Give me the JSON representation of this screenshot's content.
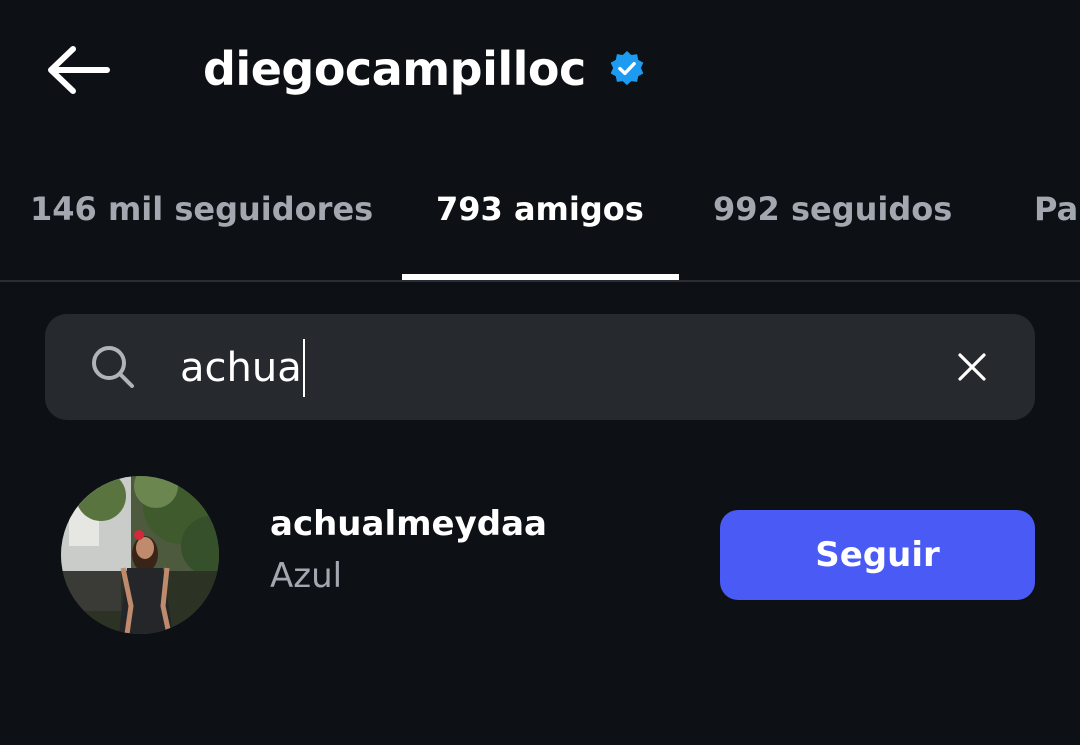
{
  "header": {
    "title": "diegocampilloc",
    "verified": true,
    "back_icon": "arrow-left-icon",
    "verified_icon": "verified-badge-icon",
    "verified_color": "#1d9bf0"
  },
  "tabs": [
    {
      "label": "146 mil seguidores",
      "active": false
    },
    {
      "label": "793 amigos",
      "active": true
    },
    {
      "label": "992 seguidos",
      "active": false
    },
    {
      "label": "Pa",
      "active": false
    }
  ],
  "search": {
    "value": "achua",
    "icon": "search-icon",
    "clear_icon": "close-icon"
  },
  "results": [
    {
      "username": "achualmeydaa",
      "subtitle": "Azul",
      "button_label": "Seguir",
      "button_color": "#4a5bf5"
    }
  ]
}
